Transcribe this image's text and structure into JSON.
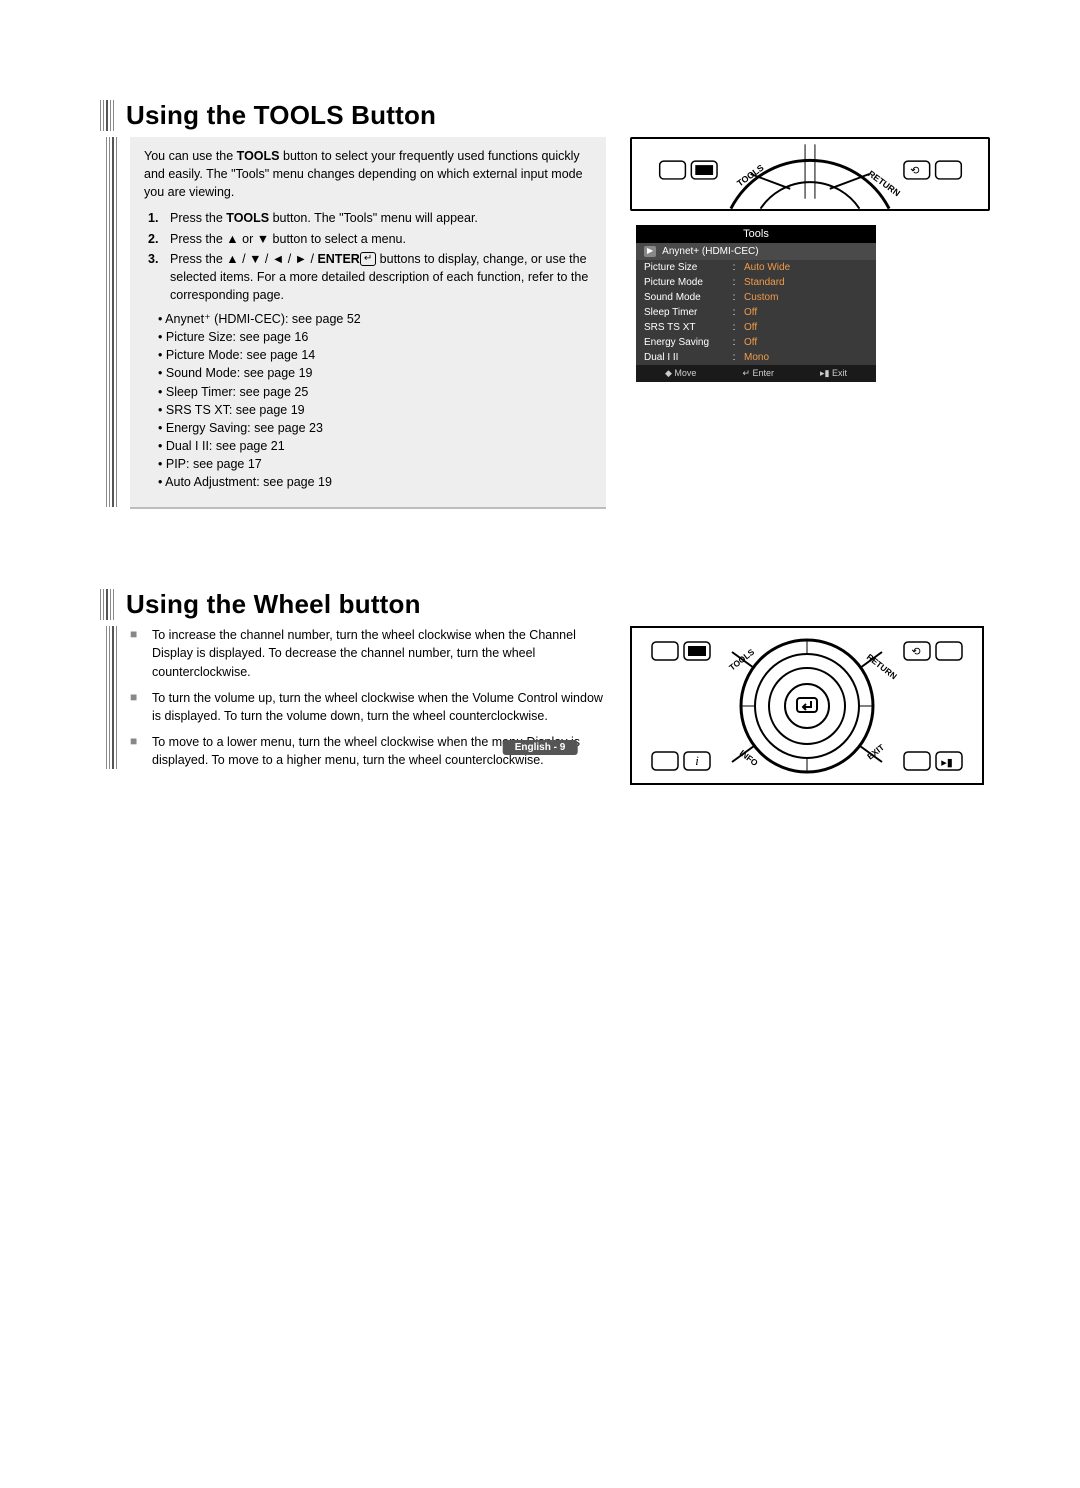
{
  "sections": {
    "tools": {
      "heading": "Using the TOOLS Button",
      "intro": "You can use the TOOLS button to select your frequently used functions quickly and easily. The \"Tools\" menu changes depending on which external input mode you are viewing.",
      "intro_bold_word": "TOOLS",
      "steps": [
        {
          "num": "1.",
          "pre": "Press the ",
          "bold": "TOOLS",
          "post": " button. The \"Tools\" menu will appear."
        },
        {
          "num": "2.",
          "text": "Press the ▲ or ▼ button to select a menu."
        },
        {
          "num": "3.",
          "text_pre": "Press the ▲ / ▼ / ◄ / ► / ",
          "bold": "ENTER",
          "enter_icon": "↵",
          "text_post": " buttons to display, change, or use the selected items. For a more detailed description of each function, refer to the corresponding page."
        }
      ],
      "sub_items": [
        "Anynet⁺ (HDMI-CEC): see page 52",
        "Picture Size: see page 16",
        "Picture Mode: see page 14",
        "Sound Mode: see page 19",
        "Sleep Timer: see page 25",
        "SRS TS XT: see page 19",
        "Energy Saving: see page 23",
        "Dual I II: see page 21",
        "PIP: see page 17",
        "Auto Adjustment: see page 19"
      ]
    },
    "wheel": {
      "heading": "Using the Wheel button",
      "items": [
        "To increase the channel number, turn the wheel clockwise when the Channel Display is displayed. To decrease the channel number, turn the wheel counterclockwise.",
        "To turn the volume up, turn the wheel clockwise when the Volume Control window is displayed. To turn the volume down, turn the wheel counterclockwise.",
        "To move to a lower menu, turn the wheel clockwise when the menu Display is displayed. To move to a higher menu, turn the wheel counterclockwise."
      ]
    }
  },
  "osd": {
    "title": "Tools",
    "highlight": "Anynet+ (HDMI-CEC)",
    "rows": [
      {
        "label": "Picture Size",
        "value": "Auto Wide"
      },
      {
        "label": "Picture Mode",
        "value": "Standard"
      },
      {
        "label": "Sound Mode",
        "value": "Custom"
      },
      {
        "label": "Sleep Timer",
        "value": "Off"
      },
      {
        "label": "SRS TS XT",
        "value": "Off"
      },
      {
        "label": "Energy Saving",
        "value": "Off"
      },
      {
        "label": "Dual I II",
        "value": "Mono"
      }
    ],
    "bottom": {
      "move": "Move",
      "enter": "Enter",
      "exit": "Exit"
    }
  },
  "remote_labels": {
    "tools": "TOOLS",
    "return": "RETURN",
    "info": "INFO",
    "exit": "EXIT"
  },
  "footer": "English - 9"
}
